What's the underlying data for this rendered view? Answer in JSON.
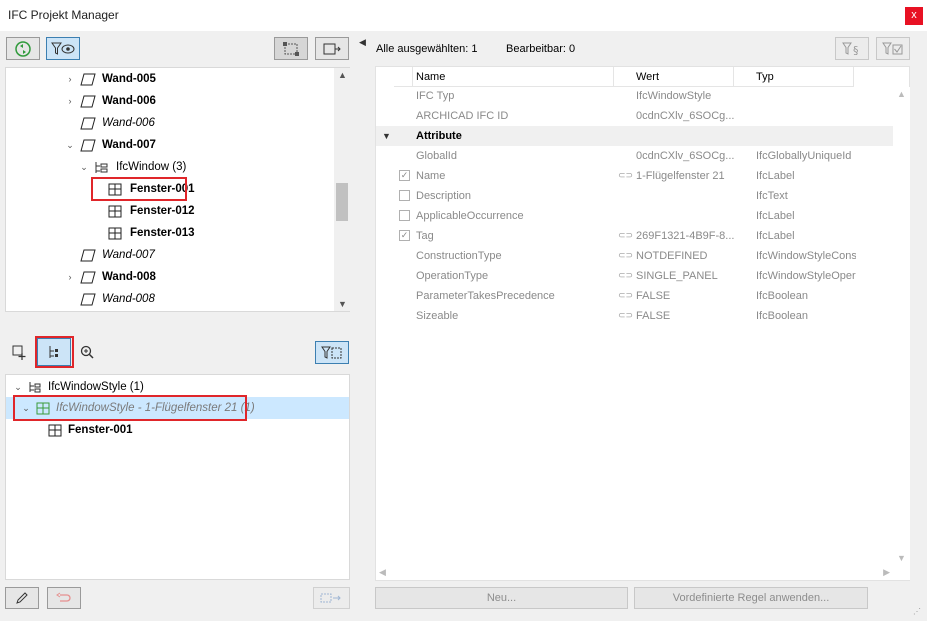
{
  "window": {
    "title": "IFC Projekt Manager",
    "close_label": "x"
  },
  "tree": [
    {
      "label": "Wand-005",
      "style": "bold",
      "expand": "›"
    },
    {
      "label": "Wand-006",
      "style": "bold",
      "expand": "›"
    },
    {
      "label": "Wand-006",
      "style": "italic",
      "expand": ""
    },
    {
      "label": "Wand-007",
      "style": "bold",
      "expand": "⌄"
    },
    {
      "label": "IfcWindow (3)",
      "style": "normal",
      "expand": "⌄"
    },
    {
      "label": "Fenster-001",
      "style": "bold",
      "expand": ""
    },
    {
      "label": "Fenster-012",
      "style": "bold",
      "expand": ""
    },
    {
      "label": "Fenster-013",
      "style": "bold",
      "expand": ""
    },
    {
      "label": "Wand-007",
      "style": "italic",
      "expand": ""
    },
    {
      "label": "Wand-008",
      "style": "bold",
      "expand": "›"
    },
    {
      "label": "Wand-008",
      "style": "italic",
      "expand": ""
    }
  ],
  "lower_tree": [
    {
      "label": "IfcWindowStyle (1)"
    },
    {
      "label": "IfcWindowStyle - 1-Flügelfenster 21 (1)"
    },
    {
      "label": "Fenster-001"
    }
  ],
  "info": {
    "select_all": "Alle ausgewählten: 1",
    "editable": "Bearbeitbar: 0"
  },
  "columns": {
    "name": "Name",
    "value": "Wert",
    "type": "Typ"
  },
  "rows_top": [
    {
      "name": "IFC Typ",
      "value": "IfcWindowStyle",
      "type": ""
    },
    {
      "name": "ARCHICAD IFC ID",
      "value": "0cdnCXlv_6SOCg...",
      "type": ""
    }
  ],
  "section": {
    "label": "Attribute"
  },
  "attributes": [
    {
      "name": "GlobalId",
      "value": "0cdnCXlv_6SOCg...",
      "type": "IfcGloballyUniqueId",
      "check": "none",
      "chain": false
    },
    {
      "name": "Name",
      "value": "1-Flügelfenster 21",
      "type": "IfcLabel",
      "check": "checked",
      "chain": true
    },
    {
      "name": "Description",
      "value": "",
      "type": "IfcText",
      "check": "empty",
      "chain": false
    },
    {
      "name": "ApplicableOccurrence",
      "value": "",
      "type": "IfcLabel",
      "check": "empty",
      "chain": false
    },
    {
      "name": "Tag",
      "value": "269F1321-4B9F-8...",
      "type": "IfcLabel",
      "check": "checked",
      "chain": true
    },
    {
      "name": "ConstructionType",
      "value": "NOTDEFINED",
      "type": "IfcWindowStyleConstructionEnum",
      "check": "none",
      "chain": true
    },
    {
      "name": "OperationType",
      "value": "SINGLE_PANEL",
      "type": "IfcWindowStyleOperationEnum",
      "check": "none",
      "chain": true
    },
    {
      "name": "ParameterTakesPrecedence",
      "value": "FALSE",
      "type": "IfcBoolean",
      "check": "none",
      "chain": true
    },
    {
      "name": "Sizeable",
      "value": "FALSE",
      "type": "IfcBoolean",
      "check": "none",
      "chain": true
    }
  ],
  "buttons": {
    "new": "Neu...",
    "apply_rule": "Vordefinierte Regel anwenden..."
  }
}
